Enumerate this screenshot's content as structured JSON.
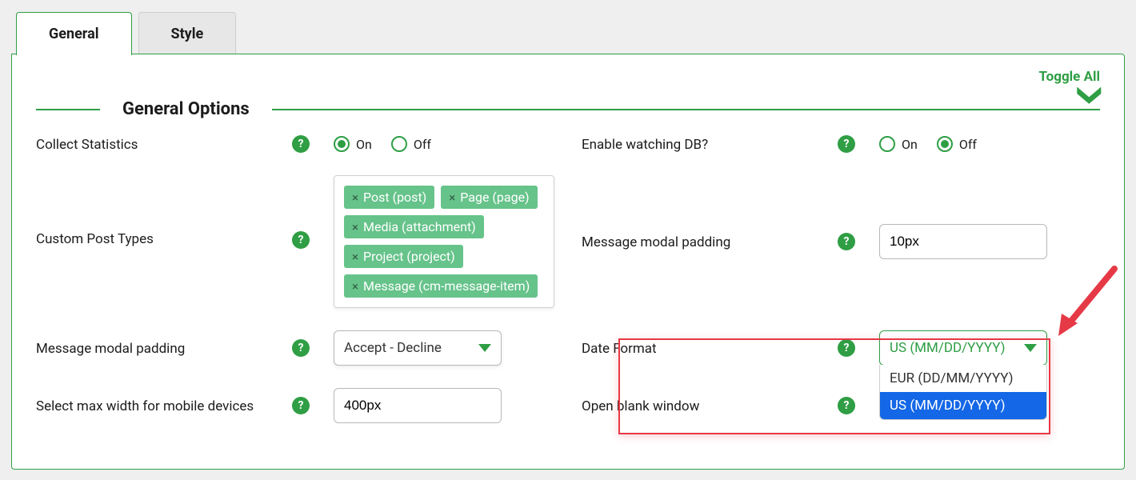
{
  "tabs": {
    "general": "General",
    "style": "Style"
  },
  "toggle_all": "Toggle All",
  "section_title": "General Options",
  "radio": {
    "on": "On",
    "off": "Off"
  },
  "left": {
    "collect_stats": {
      "label": "Collect Statistics",
      "value": "On"
    },
    "custom_post_types": {
      "label": "Custom Post Types",
      "tags": [
        "Post (post)",
        "Page (page)",
        "Media (attachment)",
        "Project (project)",
        "Message (cm-message-item)"
      ]
    },
    "message_modal_padding_select": {
      "label": "Message modal padding",
      "value": "Accept - Decline"
    },
    "max_width_mobile": {
      "label": "Select max width for mobile devices",
      "value": "400px"
    }
  },
  "right": {
    "enable_watching_db": {
      "label": "Enable watching DB?",
      "value": "Off"
    },
    "message_modal_padding_text": {
      "label": "Message modal padding",
      "value": "10px"
    },
    "date_format": {
      "label": "Date Format",
      "value": "US (MM/DD/YYYY)",
      "options": [
        "EUR (DD/MM/YYYY)",
        "US (MM/DD/YYYY)"
      ],
      "selected_index": 1
    },
    "open_blank_window": {
      "label": "Open blank window"
    }
  }
}
